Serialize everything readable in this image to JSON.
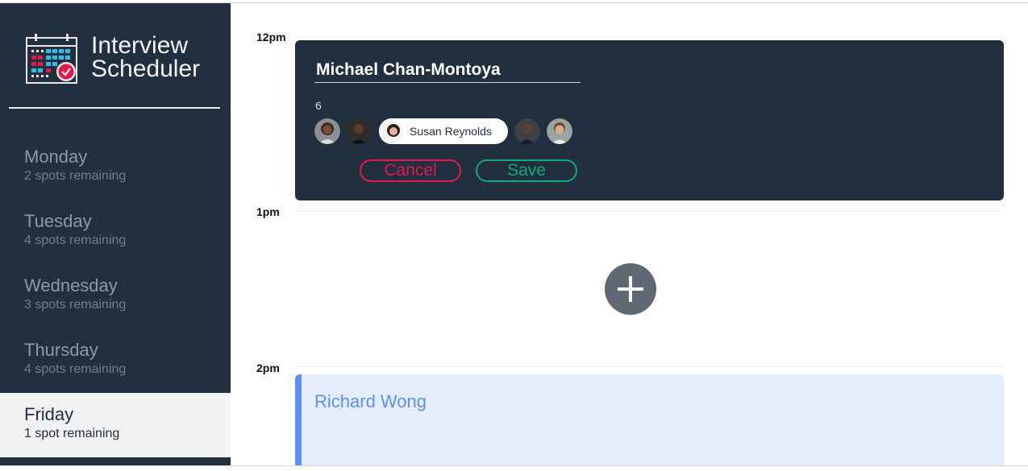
{
  "app": {
    "title_line1": "Interview",
    "title_line2": "Scheduler",
    "logo_icon": "calendar-check-icon"
  },
  "days": [
    {
      "name": "Monday",
      "spots": "2 spots remaining",
      "selected": false
    },
    {
      "name": "Tuesday",
      "spots": "4 spots remaining",
      "selected": false
    },
    {
      "name": "Wednesday",
      "spots": "3 spots remaining",
      "selected": false
    },
    {
      "name": "Thursday",
      "spots": "4 spots remaining",
      "selected": false
    },
    {
      "name": "Friday",
      "spots": "1 spot remaining",
      "selected": true
    }
  ],
  "times": [
    "12pm",
    "1pm",
    "2pm"
  ],
  "form": {
    "student_name": "Michael Chan-Montoya",
    "interviewer_label": "6",
    "selected_interviewer": "Susan Reynolds",
    "cancel_label": "Cancel",
    "save_label": "Save"
  },
  "add_icon": "plus-icon",
  "booked": {
    "student": "Richard Wong"
  },
  "colors": {
    "sidebar": "#222f3e",
    "danger": "#e5184e",
    "success": "#0eaa7a",
    "accent": "#5c8ff7",
    "booked_bg": "#e3edfc"
  }
}
